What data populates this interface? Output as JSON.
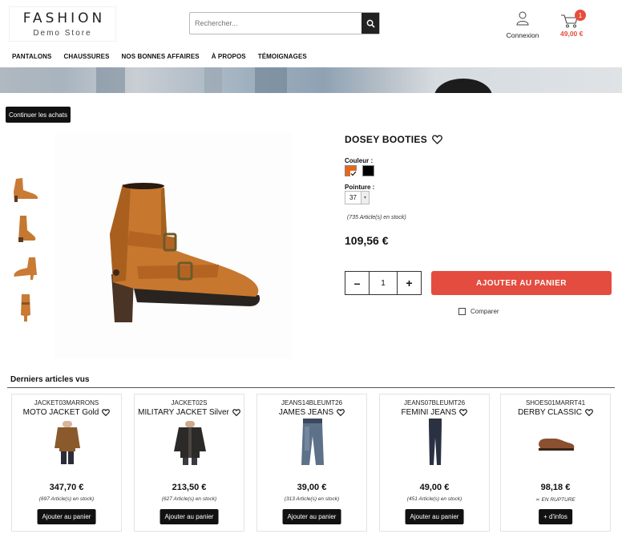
{
  "header": {
    "logo_title": "FASHION",
    "logo_subtitle": "Demo Store",
    "search_placeholder": "Rechercher...",
    "account_label": "Connexion",
    "cart_count": "1",
    "cart_total": "49,00 €"
  },
  "nav": {
    "items": [
      {
        "label": "PANTALONS"
      },
      {
        "label": "CHAUSSURES"
      },
      {
        "label": "NOS BONNES AFFAIRES"
      },
      {
        "label": "À PROPOS"
      },
      {
        "label": "TÉMOIGNAGES"
      }
    ]
  },
  "continue_label": "Continuer les achats",
  "product": {
    "title": "DOSEY BOOTIES",
    "color_label": "Couleur :",
    "colors": [
      "#e8661a",
      "#000000"
    ],
    "selected_color_index": 0,
    "size_label": "Pointure :",
    "size_value": "37",
    "stock_note": "(735 Article(s) en stock)",
    "price": "109,56 €",
    "quantity": "1",
    "minus_label": "–",
    "plus_label": "+",
    "add_to_cart_label": "AJOUTER AU PANIER",
    "compare_label": "Comparer",
    "accent_color": "#e34c3f"
  },
  "recent": {
    "title": "Derniers articles vus",
    "items": [
      {
        "ref": "JACKET03MARRONS",
        "name": "MOTO JACKET Gold",
        "price": "347,70 €",
        "stock": "(697 Article(s) en stock)",
        "button": "Ajouter au panier",
        "icon": "brown-leather-jacket-image"
      },
      {
        "ref": "JACKET02S",
        "name": "MILITARY JACKET Silver",
        "price": "213,50 €",
        "stock": "(627 Article(s) en stock)",
        "button": "Ajouter au panier",
        "icon": "black-jacket-image"
      },
      {
        "ref": "JEANS14BLEUMT26",
        "name": "JAMES JEANS",
        "price": "39,00 €",
        "stock": "(313 Article(s) en stock)",
        "button": "Ajouter au panier",
        "icon": "jeans-image"
      },
      {
        "ref": "JEANS07BLEUMT26",
        "name": "FEMINI JEANS",
        "price": "49,00 €",
        "stock": "(451 Article(s) en stock)",
        "button": "Ajouter au panier",
        "icon": "slim-jeans-image"
      },
      {
        "ref": "SHOES01MARRT41",
        "name": "DERBY CLASSIC",
        "price": "98,18 €",
        "stock": "≍ EN RUPTURE",
        "button": "+ d'infos",
        "icon": "derby-shoe-image"
      }
    ]
  }
}
